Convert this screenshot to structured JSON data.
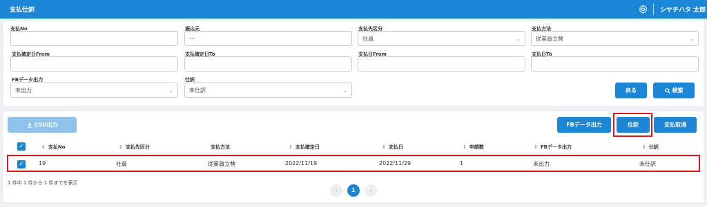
{
  "header": {
    "title": "支払仕訳",
    "user": "シヤチハタ 太郎",
    "icons": [
      "gear-icon"
    ]
  },
  "search": {
    "fields": {
      "payment_no": {
        "label": "支払No",
        "value": ""
      },
      "transfer_source": {
        "label": "振込元",
        "value": "---"
      },
      "payee_category": {
        "label": "支払先区分",
        "value": "社員"
      },
      "payment_method": {
        "label": "支払方法",
        "value": "従業員立替"
      },
      "confirm_from": {
        "label": "支払確定日From",
        "value": ""
      },
      "confirm_to": {
        "label": "支払確定日To",
        "value": ""
      },
      "pay_from": {
        "label": "支払日From",
        "value": ""
      },
      "pay_to": {
        "label": "支払日To",
        "value": ""
      },
      "fb_output": {
        "label": "FBデータ出力",
        "value": "未出力"
      },
      "journal": {
        "label": "仕訳",
        "value": "未仕訳"
      }
    },
    "back_label": "戻る",
    "search_label": "検索"
  },
  "toolbar": {
    "csv_label": "CSV出力",
    "fb_label": "FBデータ出力",
    "journal_label": "仕訳",
    "cancel_label": "支払取消"
  },
  "table": {
    "columns": [
      "支払No",
      "支払先区分",
      "支払方法",
      "支払確定日",
      "支払日",
      "申請数",
      "FBデータ出力",
      "仕訳"
    ],
    "rows": [
      {
        "checked": true,
        "cells": [
          "19",
          "社員",
          "従業員立替",
          "2022/11/19",
          "2022/11/29",
          "1",
          "未出力",
          "未仕訳"
        ]
      }
    ]
  },
  "pagination": {
    "summary": "1 件中 1 件から 1 件までを表示",
    "current": "1",
    "prev": "‹",
    "next": "›"
  },
  "colors": {
    "primary": "#1b86d6",
    "disabled": "#8ec2ea",
    "highlight": "#e0141d"
  }
}
